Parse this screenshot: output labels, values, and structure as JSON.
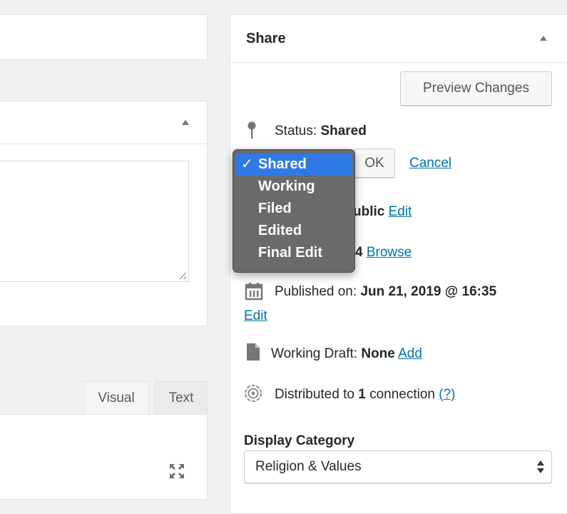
{
  "editor": {
    "tabs": [
      "Visual",
      "Text"
    ]
  },
  "share": {
    "title": "Share",
    "preview_label": "Preview Changes",
    "status_label": "Status:",
    "status_value": "Shared",
    "ok_label": "OK",
    "cancel_label": "Cancel",
    "visibility_value": "ublic",
    "edit_label": "Edit",
    "revisions_value": "4",
    "browse_label": "Browse",
    "published_label": "Published on:",
    "published_value": "Jun 21, 2019 @ 16:35",
    "published_edit": "Edit",
    "draft_label": "Working Draft:",
    "draft_value": "None",
    "draft_add": "Add",
    "distributed_prefix": "Distributed to",
    "distributed_count": "1",
    "distributed_suffix": "connection",
    "help_link": "(?)",
    "category_label": "Display Category",
    "category_value": "Religion & Values"
  },
  "status_menu": {
    "check": "✓",
    "options": [
      "Shared",
      "Working",
      "Filed",
      "Edited",
      "Final Edit"
    ],
    "selected": "Shared"
  },
  "colors": {
    "link": "#0073aa",
    "highlight": "#2f7ae6",
    "menu_bg": "#6a6a6a"
  },
  "icons": [
    "pin-icon",
    "calendar-icon",
    "document-icon",
    "distribute-icon",
    "fullscreen-icon",
    "collapse-triangle-icon"
  ]
}
